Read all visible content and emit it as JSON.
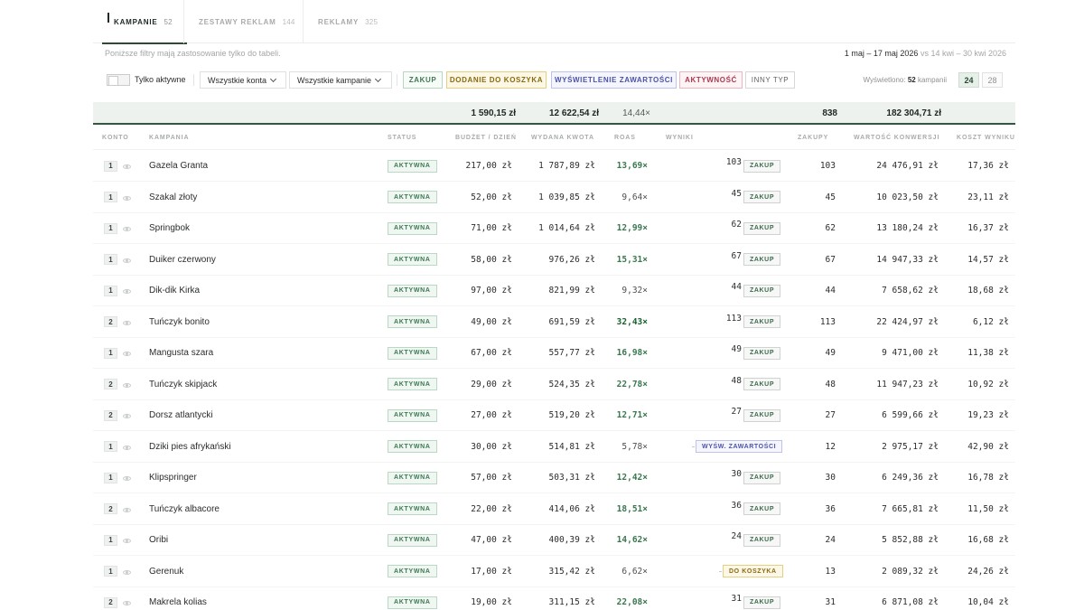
{
  "tabs": [
    {
      "label": "KAMPANIE",
      "count": "52",
      "active": true
    },
    {
      "label": "ZESTAWY REKLAM",
      "count": "144",
      "active": false
    },
    {
      "label": "REKLAMY",
      "count": "325",
      "active": false
    }
  ],
  "note": "Poniższe filtry mają zastosowanie tylko do tabeli.",
  "daterange": {
    "main": "1 maj – 17 maj 2026",
    "compare": "vs 14 kwi – 30 kwi 2026"
  },
  "filters": {
    "toggle_label": "Tylko aktywne",
    "toggle_on": false,
    "accounts_select": "Wszystkie konta",
    "campaigns_select": "Wszystkie kampanie",
    "type_chips": [
      "ZAKUP",
      "DODANIE DO KOSZYKA",
      "WYŚWIETLENIE ZAWARTOŚCI",
      "AKTYWNOŚĆ",
      "INNY TYP"
    ],
    "shown_prefix": "Wyświetlono:",
    "shown_count": "52",
    "shown_suffix": "kampanii",
    "page_sizes": [
      "24",
      "28"
    ],
    "page_size_active": "24"
  },
  "totals": {
    "budget": "1 590,15 zł",
    "spent": "12 622,54 zł",
    "roas": "14,44×",
    "purchases": "838",
    "value": "182 304,71 zł"
  },
  "columns": {
    "account": "KONTO",
    "campaign": "KAMPANIA",
    "status": "STATUS",
    "budget": "BUDŻET / DZIEŃ",
    "spent": "WYDANA KWOTA",
    "roas": "ROAS",
    "results": "WYNIKI",
    "purchases": "ZAKUPY",
    "value": "WARTOŚĆ KONWERSJI",
    "cost": "KOSZT WYNIKU"
  },
  "status_label": "AKTYWNA",
  "rows": [
    {
      "account": "1",
      "name": "Gazela Granta",
      "budget": "217,00 zł",
      "spent": "1 787,89 zł",
      "roas": "13,69×",
      "roas_level": "mid",
      "result_count": "103",
      "result_type": "ZAKUP",
      "result_kind": "zakup",
      "purchases": "103",
      "value": "24 476,91 zł",
      "cost": "17,36 zł"
    },
    {
      "account": "1",
      "name": "Szakal złoty",
      "budget": "52,00 zł",
      "spent": "1 039,85 zł",
      "roas": "9,64×",
      "roas_level": "low",
      "result_count": "45",
      "result_type": "ZAKUP",
      "result_kind": "zakup",
      "purchases": "45",
      "value": "10 023,50 zł",
      "cost": "23,11 zł"
    },
    {
      "account": "1",
      "name": "Springbok",
      "budget": "71,00 zł",
      "spent": "1 014,64 zł",
      "roas": "12,99×",
      "roas_level": "mid",
      "result_count": "62",
      "result_type": "ZAKUP",
      "result_kind": "zakup",
      "purchases": "62",
      "value": "13 180,24 zł",
      "cost": "16,37 zł"
    },
    {
      "account": "1",
      "name": "Duiker czerwony",
      "budget": "58,00 zł",
      "spent": "976,26 zł",
      "roas": "15,31×",
      "roas_level": "mid",
      "result_count": "67",
      "result_type": "ZAKUP",
      "result_kind": "zakup",
      "purchases": "67",
      "value": "14 947,33 zł",
      "cost": "14,57 zł"
    },
    {
      "account": "1",
      "name": "Dik-dik Kirka",
      "budget": "97,00 zł",
      "spent": "821,99 zł",
      "roas": "9,32×",
      "roas_level": "low",
      "result_count": "44",
      "result_type": "ZAKUP",
      "result_kind": "zakup",
      "purchases": "44",
      "value": "7 658,62 zł",
      "cost": "18,68 zł"
    },
    {
      "account": "2",
      "name": "Tuńczyk bonito",
      "budget": "49,00 zł",
      "spent": "691,59 zł",
      "roas": "32,43×",
      "roas_level": "high",
      "result_count": "113",
      "result_type": "ZAKUP",
      "result_kind": "zakup",
      "purchases": "113",
      "value": "22 424,97 zł",
      "cost": "6,12 zł"
    },
    {
      "account": "1",
      "name": "Mangusta szara",
      "budget": "67,00 zł",
      "spent": "557,77 zł",
      "roas": "16,98×",
      "roas_level": "mid",
      "result_count": "49",
      "result_type": "ZAKUP",
      "result_kind": "zakup",
      "purchases": "49",
      "value": "9 471,00 zł",
      "cost": "11,38 zł"
    },
    {
      "account": "2",
      "name": "Tuńczyk skipjack",
      "budget": "29,00 zł",
      "spent": "524,35 zł",
      "roas": "22,78×",
      "roas_level": "mid",
      "result_count": "48",
      "result_type": "ZAKUP",
      "result_kind": "zakup",
      "purchases": "48",
      "value": "11 947,23 zł",
      "cost": "10,92 zł"
    },
    {
      "account": "2",
      "name": "Dorsz atlantycki",
      "budget": "27,00 zł",
      "spent": "519,20 zł",
      "roas": "12,71×",
      "roas_level": "mid",
      "result_count": "27",
      "result_type": "ZAKUP",
      "result_kind": "zakup",
      "purchases": "27",
      "value": "6 599,66 zł",
      "cost": "19,23 zł"
    },
    {
      "account": "1",
      "name": "Dziki pies afrykański",
      "budget": "30,00 zł",
      "spent": "514,81 zł",
      "roas": "5,78×",
      "roas_level": "low",
      "result_count": "",
      "result_type": "WYŚW. ZAWARTOŚCI",
      "result_kind": "wysw",
      "purchases": "12",
      "value": "2 975,17 zł",
      "cost": "42,90 zł"
    },
    {
      "account": "1",
      "name": "Klipspringer",
      "budget": "57,00 zł",
      "spent": "503,31 zł",
      "roas": "12,42×",
      "roas_level": "mid",
      "result_count": "30",
      "result_type": "ZAKUP",
      "result_kind": "zakup",
      "purchases": "30",
      "value": "6 249,36 zł",
      "cost": "16,78 zł"
    },
    {
      "account": "2",
      "name": "Tuńczyk albacore",
      "budget": "22,00 zł",
      "spent": "414,06 zł",
      "roas": "18,51×",
      "roas_level": "mid",
      "result_count": "36",
      "result_type": "ZAKUP",
      "result_kind": "zakup",
      "purchases": "36",
      "value": "7 665,81 zł",
      "cost": "11,50 zł"
    },
    {
      "account": "1",
      "name": "Oribi",
      "budget": "47,00 zł",
      "spent": "400,39 zł",
      "roas": "14,62×",
      "roas_level": "mid",
      "result_count": "24",
      "result_type": "ZAKUP",
      "result_kind": "zakup",
      "purchases": "24",
      "value": "5 852,88 zł",
      "cost": "16,68 zł"
    },
    {
      "account": "1",
      "name": "Gerenuk",
      "budget": "17,00 zł",
      "spent": "315,42 zł",
      "roas": "6,62×",
      "roas_level": "low",
      "result_count": "",
      "result_type": "DO KOSZYKA",
      "result_kind": "koszyk",
      "purchases": "13",
      "value": "2 089,32 zł",
      "cost": "24,26 zł"
    },
    {
      "account": "2",
      "name": "Makrela kolias",
      "budget": "19,00 zł",
      "spent": "311,15 zł",
      "roas": "22,08×",
      "roas_level": "mid",
      "result_count": "31",
      "result_type": "ZAKUP",
      "result_kind": "zakup",
      "purchases": "31",
      "value": "6 871,08 zł",
      "cost": "10,04 zł"
    }
  ]
}
